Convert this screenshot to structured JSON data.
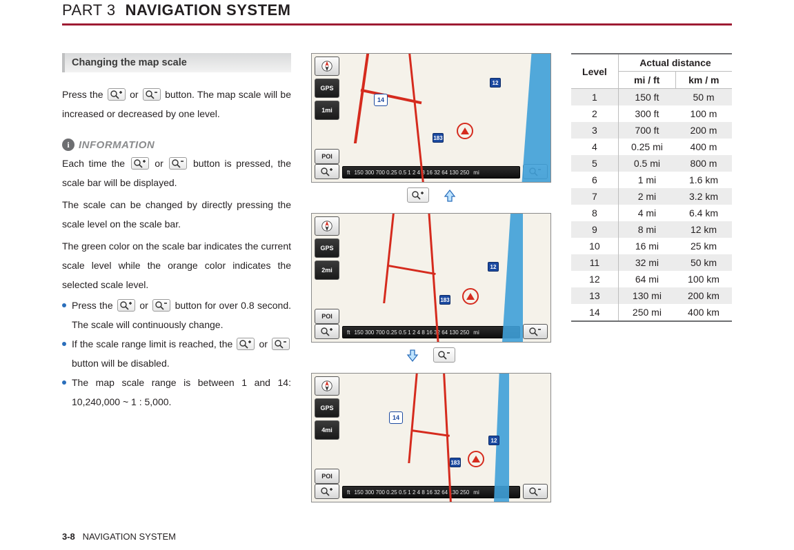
{
  "header": {
    "part": "PART 3",
    "title": "NAVIGATION SYSTEM"
  },
  "subheading": "Changing the map scale",
  "para1_a": "Press the ",
  "para1_b": " or ",
  "para1_c": " button. The map scale will be increased or decreased by one level.",
  "info_label": "INFORMATION",
  "info_p1_a": "Each time the ",
  "info_p1_b": " or ",
  "info_p1_c": " button is pressed, the scale bar will be displayed.",
  "info_p2": "The scale can be changed by directly pressing the scale level on the scale bar.",
  "info_p3": "The green color on the scale bar indicates the current scale level while the orange color indicates the selected scale level.",
  "bullet1_a": "Press the ",
  "bullet1_b": " or ",
  "bullet1_c": " button for over 0.8 second. The scale will continuously change.",
  "bullet2_a": "If the scale range limit is reached, the ",
  "bullet2_b": " or ",
  "bullet2_c": " button will be disabled.",
  "bullet3": "The map scale range is between 1 and 14: 10,240,000 ~ 1 : 5,000.",
  "map": {
    "gps": "GPS",
    "poi": "POI",
    "scale_labels": [
      "1mi",
      "2mi",
      "4mi"
    ],
    "route_14": "14",
    "route_183": "183",
    "exit_12": "12",
    "scalebar_ticks": "150  300  700  0.25  0.5   1    2    4    8   16   32   64  130  250",
    "scalebar_unit_ft": "ft",
    "scalebar_unit_mi": "mi"
  },
  "table": {
    "h_level": "Level",
    "h_actual": "Actual distance",
    "h_mi": "mi / ft",
    "h_km": "km / m",
    "rows": [
      {
        "lvl": "1",
        "mi": "150 ft",
        "km": "50 m"
      },
      {
        "lvl": "2",
        "mi": "300 ft",
        "km": "100 m"
      },
      {
        "lvl": "3",
        "mi": "700 ft",
        "km": "200 m"
      },
      {
        "lvl": "4",
        "mi": "0.25 mi",
        "km": "400 m"
      },
      {
        "lvl": "5",
        "mi": "0.5 mi",
        "km": "800 m"
      },
      {
        "lvl": "6",
        "mi": "1 mi",
        "km": "1.6 km"
      },
      {
        "lvl": "7",
        "mi": "2 mi",
        "km": "3.2 km"
      },
      {
        "lvl": "8",
        "mi": "4 mi",
        "km": "6.4 km"
      },
      {
        "lvl": "9",
        "mi": "8 mi",
        "km": "12 km"
      },
      {
        "lvl": "10",
        "mi": "16 mi",
        "km": "25 km"
      },
      {
        "lvl": "11",
        "mi": "32 mi",
        "km": "50 km"
      },
      {
        "lvl": "12",
        "mi": "64 mi",
        "km": "100 km"
      },
      {
        "lvl": "13",
        "mi": "130 mi",
        "km": "200 km"
      },
      {
        "lvl": "14",
        "mi": "250 mi",
        "km": "400 km"
      }
    ]
  },
  "footer": {
    "page": "3-8",
    "section": "NAVIGATION SYSTEM"
  }
}
